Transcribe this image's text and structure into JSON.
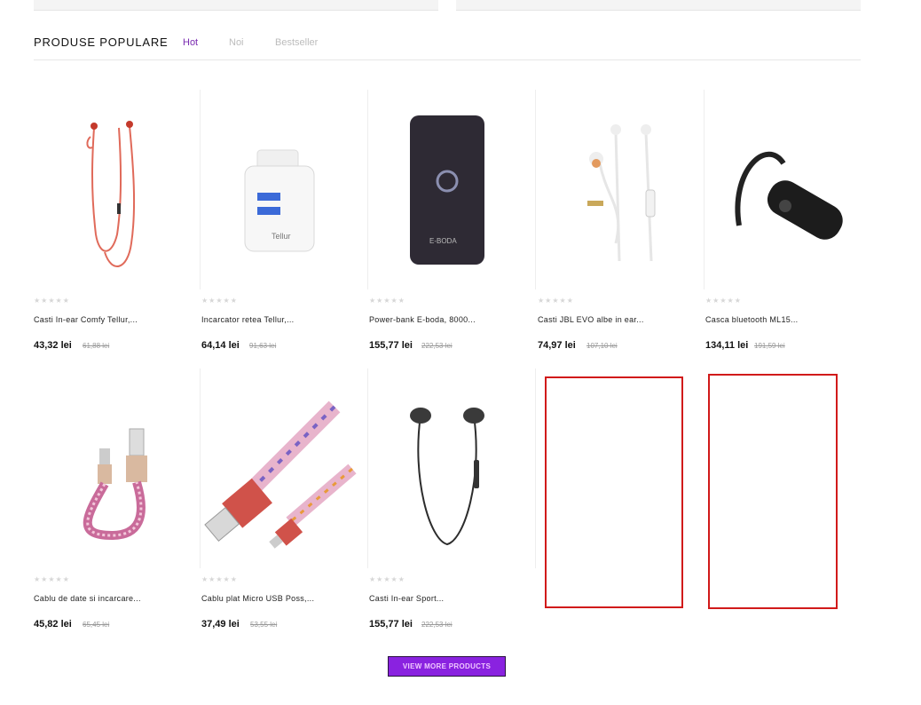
{
  "section": {
    "title": "PRODUSE POPULARE",
    "tabs": [
      "Hot",
      "Noi",
      "Bestseller"
    ]
  },
  "products": [
    {
      "name": "Casti In-ear Comfy Tellur,...",
      "price": "43,32 lei",
      "old_price": "61,88 lei",
      "rating": 0,
      "image": "red-earphones"
    },
    {
      "name": "Incarcator retea Tellur,...",
      "price": "64,14 lei",
      "old_price": "91,63 lei",
      "rating": 0,
      "image": "wall-charger"
    },
    {
      "name": "Power-bank E-boda, 8000...",
      "price": "155,77 lei",
      "old_price": "222,53 lei",
      "rating": 0,
      "image": "power-bank"
    },
    {
      "name": "Casti JBL EVO albe in ear...",
      "price": "74,97 lei",
      "old_price": "107,10 lei",
      "rating": 0,
      "image": "white-earphones"
    },
    {
      "name": "Casca bluetooth ML15...",
      "price": "134,11 lei",
      "old_price": "191,59 lei",
      "rating": 0,
      "image": "bluetooth-headset"
    },
    {
      "name": "Cablu de date si incarcare...",
      "price": "45,82 lei",
      "old_price": "65,45 lei",
      "rating": 0,
      "image": "usb-c-cable"
    },
    {
      "name": "Cablu plat Micro USB Poss,...",
      "price": "37,49 lei",
      "old_price": "53,55 lei",
      "rating": 0,
      "image": "micro-usb-cable"
    },
    {
      "name": "Casti In-ear Sport...",
      "price": "155,77 lei",
      "old_price": "222,53 lei",
      "rating": 0,
      "image": "sport-earphones"
    }
  ],
  "button": {
    "label": "VIEW MORE PRODUCTS"
  },
  "colors": {
    "accent": "#8a22e0",
    "active_tab": "#7a2bb0",
    "highlight_box": "#d11a1a"
  }
}
